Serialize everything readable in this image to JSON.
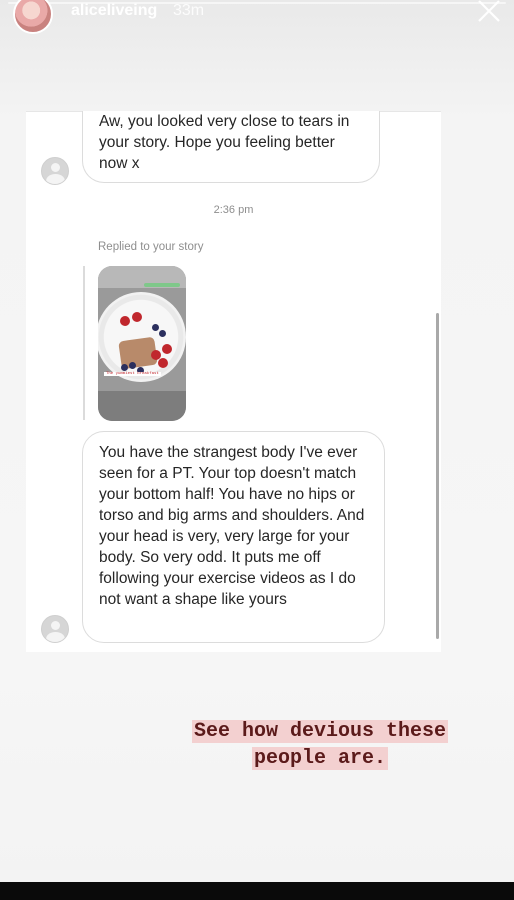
{
  "header": {
    "username": "aliceliveing",
    "time_ago": "33m",
    "close_icon": "close-icon"
  },
  "conversation": {
    "message_1": "Aw, you looked very close to tears in your story. Hope you feeling better now x",
    "timestamp": "2:36 pm",
    "replied_label": "Replied to your story",
    "story_thumbnail_caption": "The yummiest breakfast",
    "message_2": "You have the strangest body I've ever seen for a PT. Your top doesn't match your bottom half! You have no hips or torso and big arms and shoulders. And your head is very, very large for your body.  So very odd. It puts me off following your exercise videos as I do not want a shape like yours"
  },
  "caption": {
    "line_1": "See how devious these",
    "line_2": "people are."
  },
  "colors": {
    "caption_highlight": "#f3d0d0",
    "caption_text": "#5b1a1a"
  }
}
